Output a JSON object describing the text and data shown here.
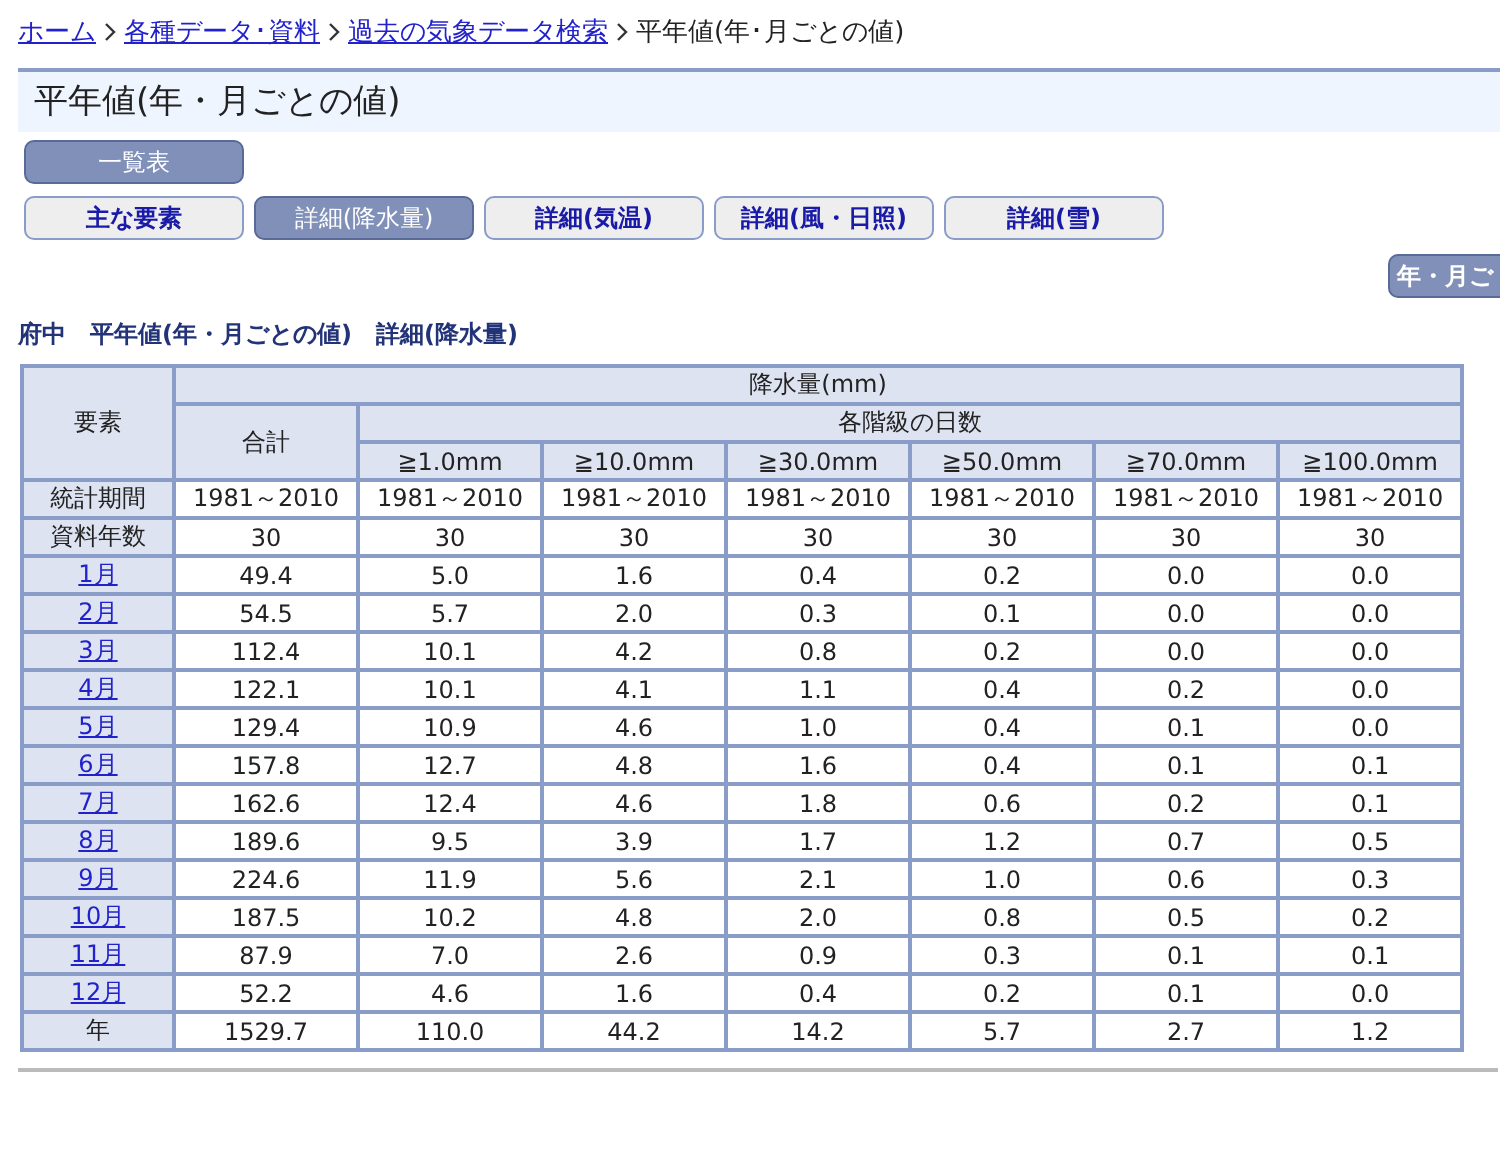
{
  "breadcrumb": [
    {
      "label": "ホーム",
      "link": true
    },
    {
      "label": "各種データ･資料",
      "link": true
    },
    {
      "label": "過去の気象データ検索",
      "link": true
    },
    {
      "label": "平年値(年･月ごとの値)",
      "link": false
    }
  ],
  "page_title": "平年値(年・月ごとの値)",
  "list_button": "一覧表",
  "tabs": [
    {
      "label": "主な要素",
      "selected": false
    },
    {
      "label": "詳細(降水量)",
      "selected": true
    },
    {
      "label": "詳細(気温)",
      "selected": false
    },
    {
      "label": "詳細(風・日照)",
      "selected": false
    },
    {
      "label": "詳細(雪)",
      "selected": false
    }
  ],
  "side_button": "年・月ご",
  "caption": "府中　平年値(年・月ごとの値)　詳細(降水量)",
  "table": {
    "row_header": "要素",
    "group_header": "降水量(mm)",
    "total_header": "合計",
    "days_header": "各階級の日数",
    "thresholds": [
      "≧1.0mm",
      "≧10.0mm",
      "≧30.0mm",
      "≧50.0mm",
      "≧70.0mm",
      "≧100.0mm"
    ],
    "rows": [
      {
        "label": "統計期間",
        "link": false,
        "values": [
          "1981～2010",
          "1981～2010",
          "1981～2010",
          "1981～2010",
          "1981～2010",
          "1981～2010",
          "1981～2010"
        ]
      },
      {
        "label": "資料年数",
        "link": false,
        "values": [
          "30",
          "30",
          "30",
          "30",
          "30",
          "30",
          "30"
        ]
      },
      {
        "label": "1月",
        "link": true,
        "values": [
          "49.4",
          "5.0",
          "1.6",
          "0.4",
          "0.2",
          "0.0",
          "0.0"
        ]
      },
      {
        "label": "2月",
        "link": true,
        "values": [
          "54.5",
          "5.7",
          "2.0",
          "0.3",
          "0.1",
          "0.0",
          "0.0"
        ]
      },
      {
        "label": "3月",
        "link": true,
        "values": [
          "112.4",
          "10.1",
          "4.2",
          "0.8",
          "0.2",
          "0.0",
          "0.0"
        ]
      },
      {
        "label": "4月",
        "link": true,
        "values": [
          "122.1",
          "10.1",
          "4.1",
          "1.1",
          "0.4",
          "0.2",
          "0.0"
        ]
      },
      {
        "label": "5月",
        "link": true,
        "values": [
          "129.4",
          "10.9",
          "4.6",
          "1.0",
          "0.4",
          "0.1",
          "0.0"
        ]
      },
      {
        "label": "6月",
        "link": true,
        "values": [
          "157.8",
          "12.7",
          "4.8",
          "1.6",
          "0.4",
          "0.1",
          "0.1"
        ]
      },
      {
        "label": "7月",
        "link": true,
        "values": [
          "162.6",
          "12.4",
          "4.6",
          "1.8",
          "0.6",
          "0.2",
          "0.1"
        ]
      },
      {
        "label": "8月",
        "link": true,
        "values": [
          "189.6",
          "9.5",
          "3.9",
          "1.7",
          "1.2",
          "0.7",
          "0.5"
        ]
      },
      {
        "label": "9月",
        "link": true,
        "values": [
          "224.6",
          "11.9",
          "5.6",
          "2.1",
          "1.0",
          "0.6",
          "0.3"
        ]
      },
      {
        "label": "10月",
        "link": true,
        "values": [
          "187.5",
          "10.2",
          "4.8",
          "2.0",
          "0.8",
          "0.5",
          "0.2"
        ]
      },
      {
        "label": "11月",
        "link": true,
        "values": [
          "87.9",
          "7.0",
          "2.6",
          "0.9",
          "0.3",
          "0.1",
          "0.1"
        ]
      },
      {
        "label": "12月",
        "link": true,
        "values": [
          "52.2",
          "4.6",
          "1.6",
          "0.4",
          "0.2",
          "0.1",
          "0.0"
        ]
      },
      {
        "label": "年",
        "link": false,
        "values": [
          "1529.7",
          "110.0",
          "44.2",
          "14.2",
          "5.7",
          "2.7",
          "1.2"
        ]
      }
    ]
  }
}
